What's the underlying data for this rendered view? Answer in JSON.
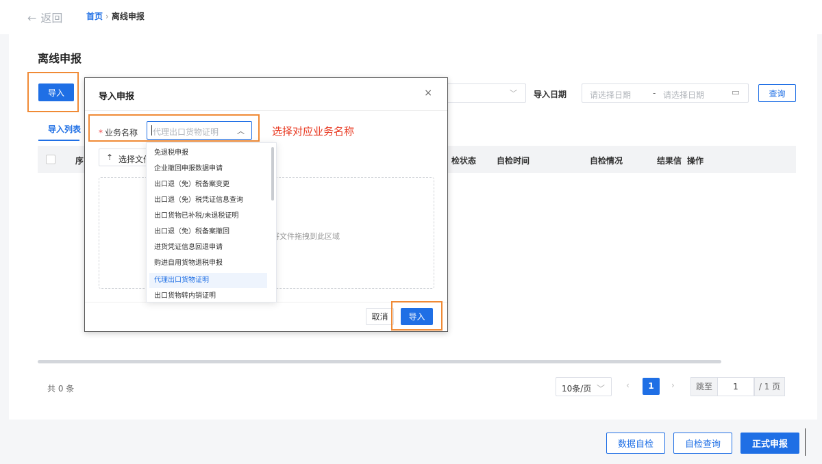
{
  "nav": {
    "back_icon": "←",
    "back_label": "返回",
    "crumb_home": "首页",
    "crumb_sep": "›",
    "crumb_current": "离线申报"
  },
  "page": {
    "title": "离线申报"
  },
  "toolbar": {
    "import_label": "导入",
    "date_label": "导入日期",
    "date_start_placeholder": "请选择日期",
    "date_sep": "-",
    "date_end_placeholder": "请选择日期",
    "query_label": "查询"
  },
  "tabs": {
    "import_list": "导入列表"
  },
  "table": {
    "headers": [
      "序",
      "检状态",
      "自检时间",
      "自检情况",
      "结果信",
      "操作"
    ]
  },
  "pagination": {
    "total": "共 0 条",
    "page_size": "10条/页",
    "prev": "‹",
    "current": "1",
    "next": "›",
    "jump_label": "跳至",
    "jump_value": "1",
    "total_pages": "/ 1 页"
  },
  "bottom": {
    "self_check": "数据自检",
    "check_query": "自检查询",
    "submit": "正式申报"
  },
  "modal": {
    "title": "导入申报",
    "close": "×",
    "biz_label_required": "*",
    "biz_label": "业务名称",
    "biz_value": "代理出口货物证明",
    "choose_file": "选择文件",
    "drop_text": "将文件拖拽到此区域",
    "cancel": "取消",
    "ok": "导入"
  },
  "dropdown": {
    "items": [
      "免退税申报",
      "企业撤回申报数据申请",
      "出口退（免）税备案变更",
      "出口退（免）税凭证信息查询",
      "出口货物已补税/未退税证明",
      "出口退（免）税备案撤回",
      "进货凭证信息回退申请",
      "购进自用货物退税申报",
      "代理出口货物证明",
      "出口货物转内销证明"
    ],
    "selected_index": 8
  },
  "annotation": "选择对应业务名称",
  "colors": {
    "primary": "#1f6fe5",
    "highlight": "#f08a35",
    "annotation": "#e8371f"
  }
}
